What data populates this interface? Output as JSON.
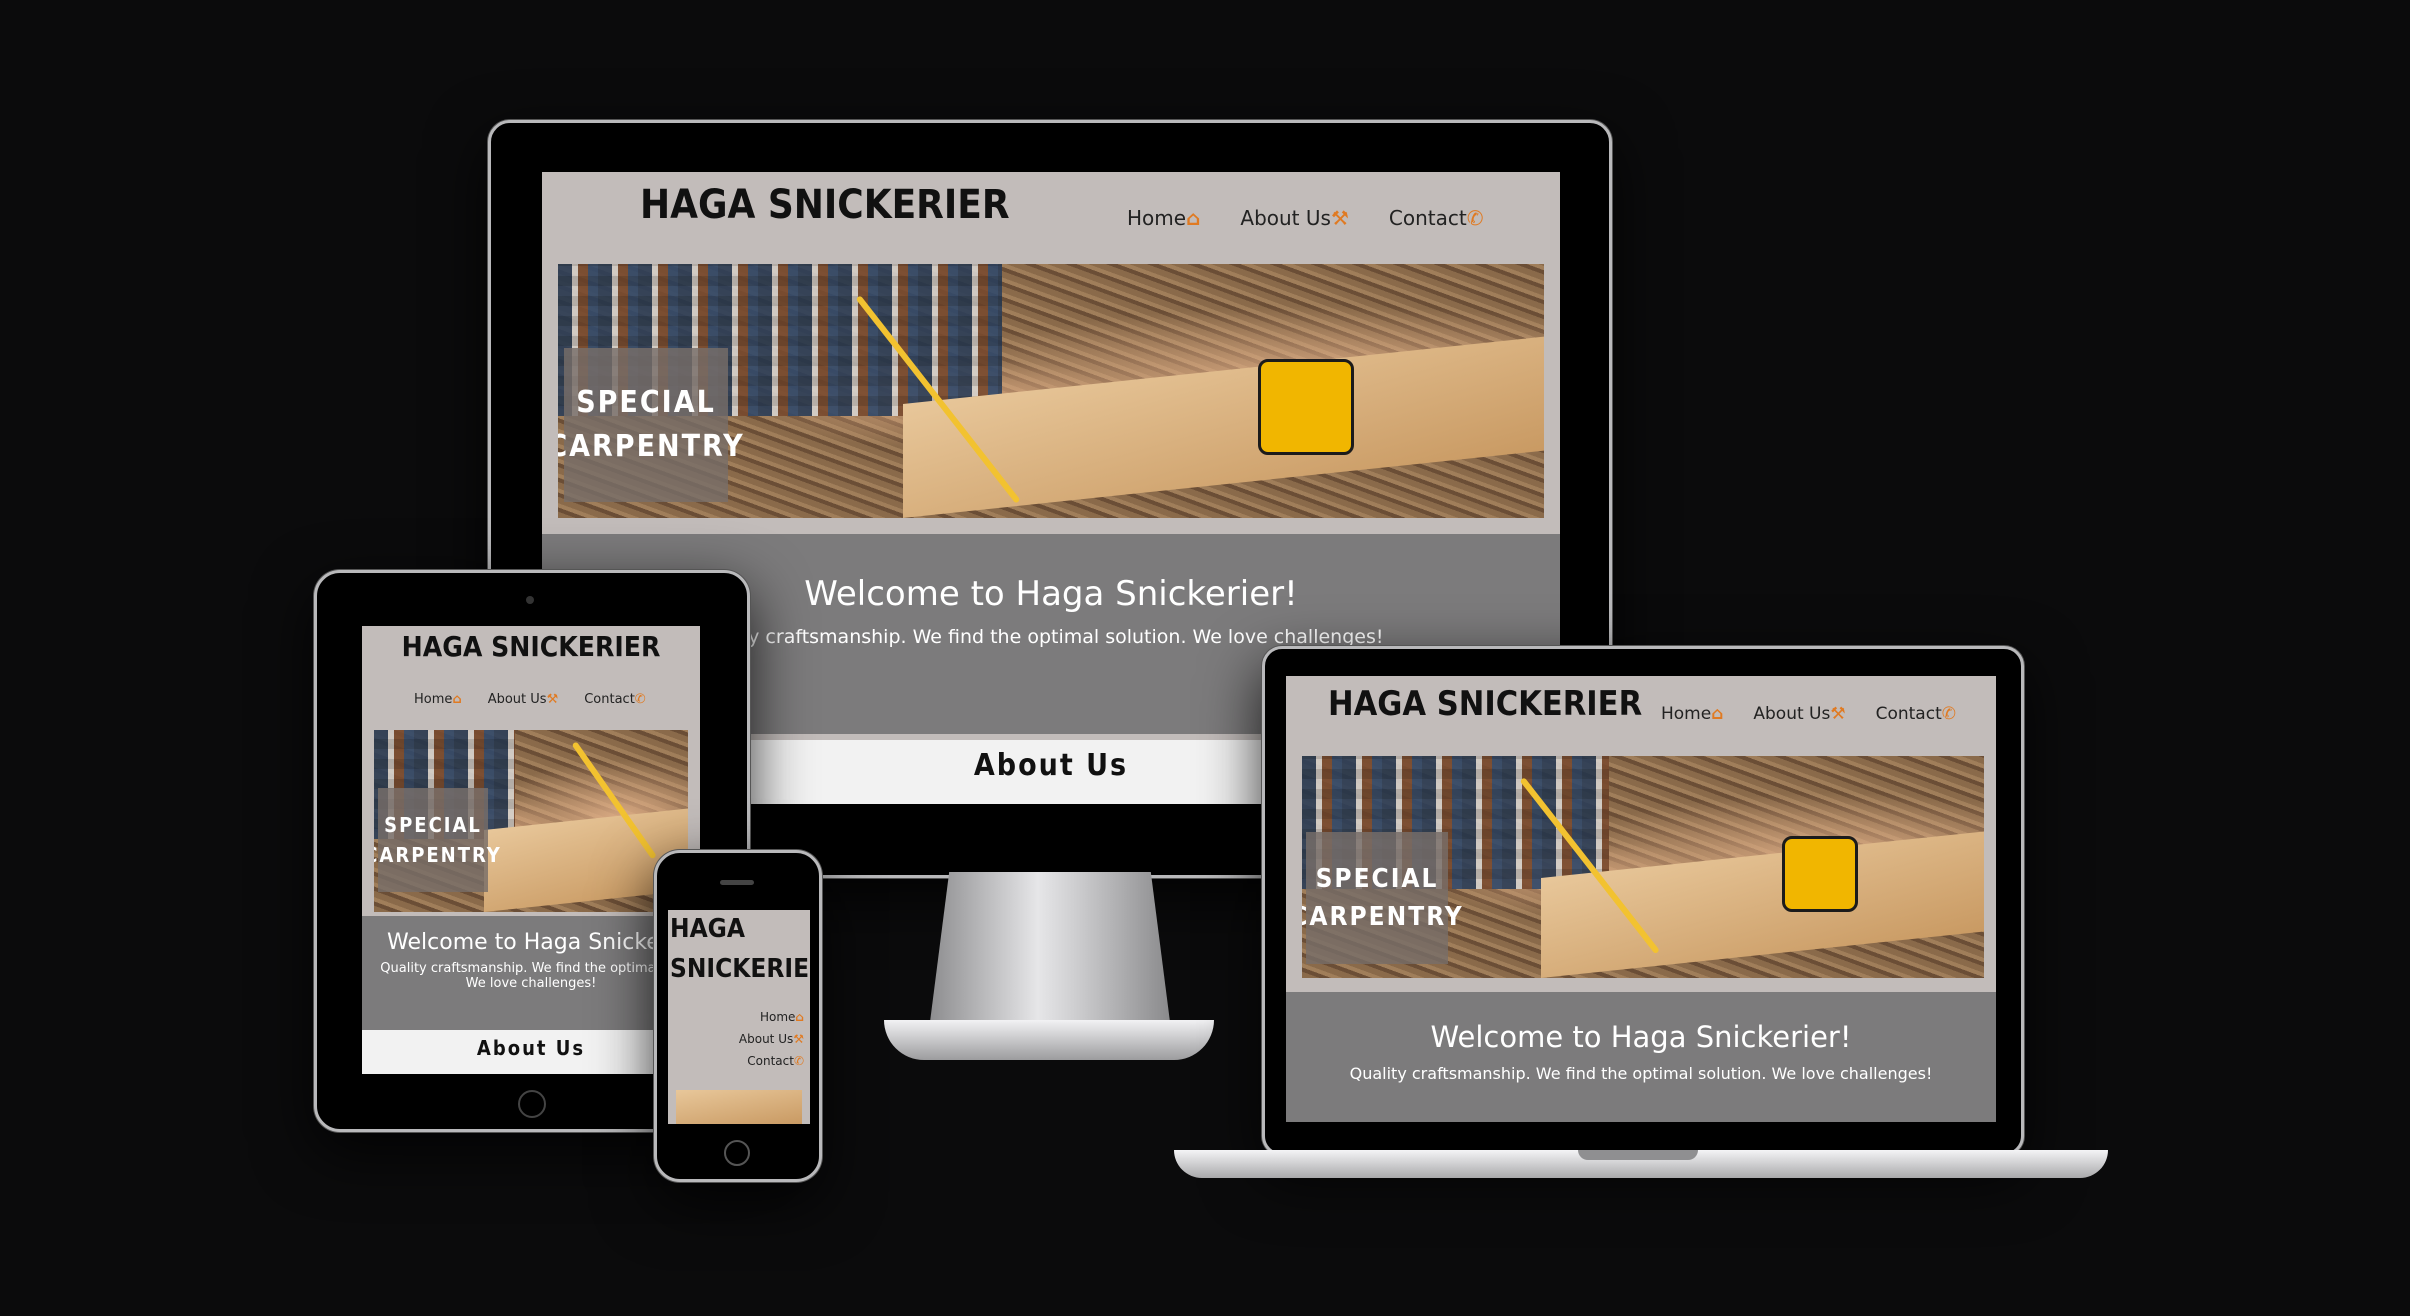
{
  "site": {
    "logo": "HAGA SNICKERIER",
    "logo_line1": "HAGA",
    "logo_line2": "SNICKERIER",
    "nav": [
      {
        "label": "Home",
        "icon": "home-icon",
        "glyph": "⌂"
      },
      {
        "label": "About Us",
        "icon": "hammer-icon",
        "glyph": "⚒"
      },
      {
        "label": "Contact",
        "icon": "phone-icon",
        "glyph": "✆"
      }
    ],
    "hero_badge_line1": "SPECIAL",
    "hero_badge_line2": "CARPENTRY",
    "welcome_title": "Welcome to Haga Snickerier!",
    "welcome_text": "Quality craftsmanship. We find the optimal solution. We love challenges!",
    "welcome_text_line1": "Quality craftsmanship. We find the optimal solution.",
    "welcome_text_line2": "We love challenges!",
    "welcome_title_clipped": "Welcome to Haga Snickeri",
    "monitor_text_clipped": "ality craftsmanship. We find the optimal solution. We love challenges!",
    "tablet_text_clipped": "Quality craftsmanship. We find the optimal sol",
    "about_title": "About Us"
  },
  "colors": {
    "background": "#0b0b0c",
    "header": "#c2bcba",
    "welcome": "#7c7b7c",
    "accent": "#e07a22"
  }
}
